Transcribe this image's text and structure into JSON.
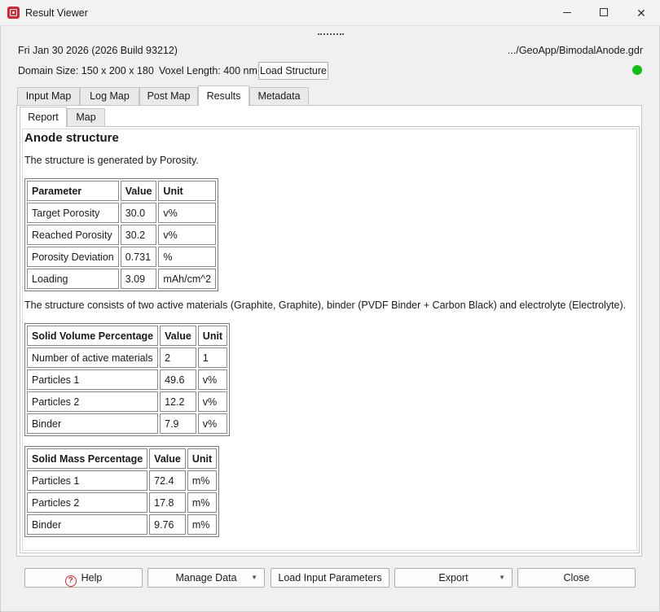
{
  "window": {
    "title": "Result Viewer"
  },
  "info": {
    "date": "Fri Jan 30 2026 (2026 Build 93212)",
    "path": ".../GeoApp/BimodalAnode.gdr",
    "domain": "Domain Size: 150 x 200 x 180",
    "voxel": "Voxel Length: 400 nm",
    "load_structure_label": "Load Structure",
    "status_color": "#10c010"
  },
  "tabs": [
    "Input Map",
    "Log Map",
    "Post Map",
    "Results",
    "Metadata"
  ],
  "active_tab": "Results",
  "subtabs": [
    "Report",
    "Map"
  ],
  "active_subtab": "Report",
  "report": {
    "title": "Anode structure",
    "intro": "The structure is generated by Porosity.",
    "porosity_table": {
      "headers": [
        "Parameter",
        "Value",
        "Unit"
      ],
      "rows": [
        [
          "Target Porosity",
          "30.0",
          "v%"
        ],
        [
          "Reached Porosity",
          "30.2",
          "v%"
        ],
        [
          "Porosity Deviation",
          "0.731",
          "%"
        ],
        [
          "Loading",
          "3.09",
          "mAh/cm^2"
        ]
      ]
    },
    "composition": "The structure consists of two active materials (Graphite, Graphite), binder (PVDF Binder + Carbon Black) and electrolyte (Electrolyte).",
    "volume_table": {
      "headers": [
        "Solid Volume Percentage",
        "Value",
        "Unit"
      ],
      "rows": [
        [
          "Number of active materials",
          "2",
          "1"
        ],
        [
          "Particles 1",
          "49.6",
          "v%"
        ],
        [
          "Particles 2",
          "12.2",
          "v%"
        ],
        [
          "Binder",
          "7.9",
          "v%"
        ]
      ]
    },
    "mass_table": {
      "headers": [
        "Solid Mass Percentage",
        "Value",
        "Unit"
      ],
      "rows": [
        [
          "Particles 1",
          "72.4",
          "m%"
        ],
        [
          "Particles 2",
          "17.8",
          "m%"
        ],
        [
          "Binder",
          "9.76",
          "m%"
        ]
      ]
    }
  },
  "buttons": {
    "help": "Help",
    "manage_data": "Manage Data",
    "load_input": "Load Input Parameters",
    "export": "Export",
    "close": "Close"
  }
}
